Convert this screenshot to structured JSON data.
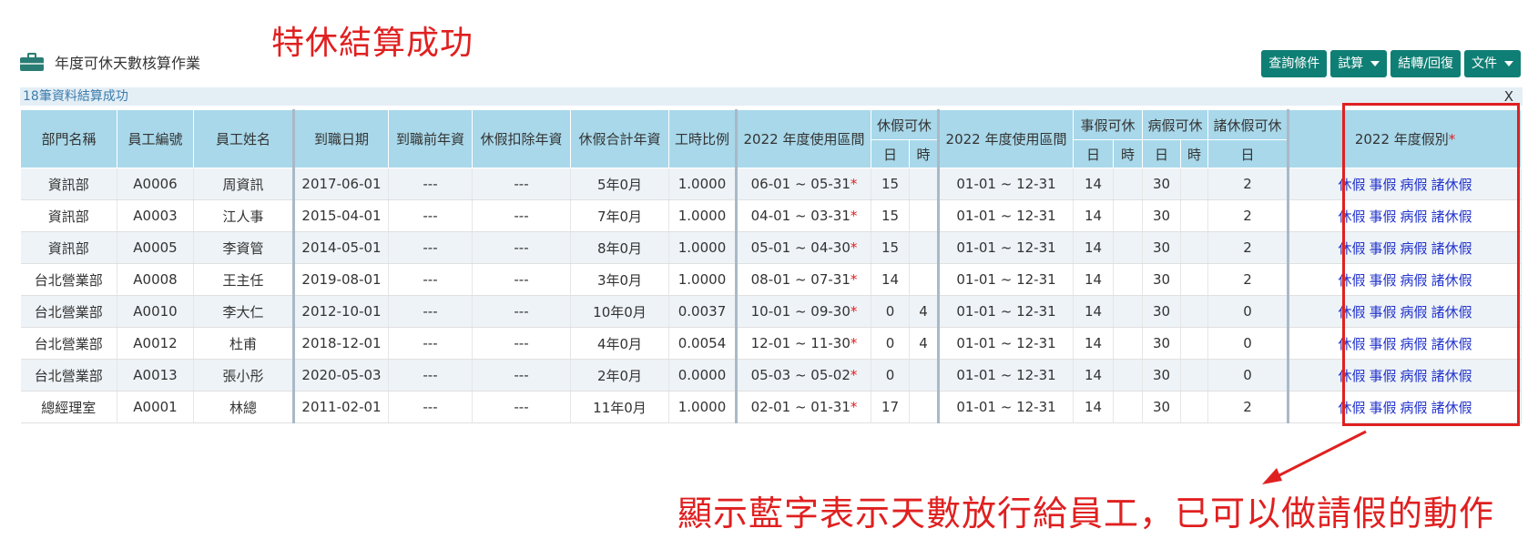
{
  "annotation": {
    "title": "特休結算成功",
    "note": "顯示藍字表示天數放行給員工，已可以做請假的動作"
  },
  "page": {
    "title": "年度可休天數核算作業",
    "status": "18筆資料結算成功",
    "close": "X"
  },
  "toolbar": {
    "query": "查詢條件",
    "trial": "試算",
    "settle": "結轉/回復",
    "docs": "文件"
  },
  "table": {
    "headers": {
      "dept": "部門名稱",
      "emp_no": "員工編號",
      "emp_name": "員工姓名",
      "hire_date": "到職日期",
      "prior_years": "到職前年資",
      "deduct_years": "休假扣除年資",
      "total_years": "休假合計年資",
      "work_ratio": "工時比例",
      "range1": "2022 年度使用區間",
      "annual": "休假可休",
      "range2": "2022 年度使用區間",
      "personal": "事假可休",
      "sick": "病假可休",
      "other": "諸休假可休",
      "types": "2022 年度假別",
      "day": "日",
      "hour": "時"
    },
    "leave_types": [
      "休假",
      "事假",
      "病假",
      "諸休假"
    ],
    "rows": [
      {
        "dept": "資訊部",
        "emp_no": "A0006",
        "emp_name": "周資訊",
        "hire_date": "2017-06-01",
        "prior_years": "---",
        "deduct_years": "---",
        "total_years": "5年0月",
        "work_ratio": "1.0000",
        "range1": "06-01 ~ 05-31",
        "annual_day": "15",
        "annual_hour": "",
        "range2": "01-01 ~ 12-31",
        "personal_day": "14",
        "personal_hour": "",
        "sick_day": "30",
        "sick_hour": "",
        "other_day": "2"
      },
      {
        "dept": "資訊部",
        "emp_no": "A0003",
        "emp_name": "江人事",
        "hire_date": "2015-04-01",
        "prior_years": "---",
        "deduct_years": "---",
        "total_years": "7年0月",
        "work_ratio": "1.0000",
        "range1": "04-01 ~ 03-31",
        "annual_day": "15",
        "annual_hour": "",
        "range2": "01-01 ~ 12-31",
        "personal_day": "14",
        "personal_hour": "",
        "sick_day": "30",
        "sick_hour": "",
        "other_day": "2"
      },
      {
        "dept": "資訊部",
        "emp_no": "A0005",
        "emp_name": "李資管",
        "hire_date": "2014-05-01",
        "prior_years": "---",
        "deduct_years": "---",
        "total_years": "8年0月",
        "work_ratio": "1.0000",
        "range1": "05-01 ~ 04-30",
        "annual_day": "15",
        "annual_hour": "",
        "range2": "01-01 ~ 12-31",
        "personal_day": "14",
        "personal_hour": "",
        "sick_day": "30",
        "sick_hour": "",
        "other_day": "2"
      },
      {
        "dept": "台北營業部",
        "emp_no": "A0008",
        "emp_name": "王主任",
        "hire_date": "2019-08-01",
        "prior_years": "---",
        "deduct_years": "---",
        "total_years": "3年0月",
        "work_ratio": "1.0000",
        "range1": "08-01 ~ 07-31",
        "annual_day": "14",
        "annual_hour": "",
        "range2": "01-01 ~ 12-31",
        "personal_day": "14",
        "personal_hour": "",
        "sick_day": "30",
        "sick_hour": "",
        "other_day": "2"
      },
      {
        "dept": "台北營業部",
        "emp_no": "A0010",
        "emp_name": "李大仁",
        "hire_date": "2012-10-01",
        "prior_years": "---",
        "deduct_years": "---",
        "total_years": "10年0月",
        "work_ratio": "0.0037",
        "range1": "10-01 ~ 09-30",
        "annual_day": "0",
        "annual_hour": "4",
        "range2": "01-01 ~ 12-31",
        "personal_day": "14",
        "personal_hour": "",
        "sick_day": "30",
        "sick_hour": "",
        "other_day": "0"
      },
      {
        "dept": "台北營業部",
        "emp_no": "A0012",
        "emp_name": "杜甫",
        "hire_date": "2018-12-01",
        "prior_years": "---",
        "deduct_years": "---",
        "total_years": "4年0月",
        "work_ratio": "0.0054",
        "range1": "12-01 ~ 11-30",
        "annual_day": "0",
        "annual_hour": "4",
        "range2": "01-01 ~ 12-31",
        "personal_day": "14",
        "personal_hour": "",
        "sick_day": "30",
        "sick_hour": "",
        "other_day": "0"
      },
      {
        "dept": "台北營業部",
        "emp_no": "A0013",
        "emp_name": "張小彤",
        "hire_date": "2020-05-03",
        "prior_years": "---",
        "deduct_years": "---",
        "total_years": "2年0月",
        "work_ratio": "0.0000",
        "range1": "05-03 ~ 05-02",
        "annual_day": "0",
        "annual_hour": "",
        "range2": "01-01 ~ 12-31",
        "personal_day": "14",
        "personal_hour": "",
        "sick_day": "30",
        "sick_hour": "",
        "other_day": "0"
      },
      {
        "dept": "總經理室",
        "emp_no": "A0001",
        "emp_name": "林總",
        "hire_date": "2011-02-01",
        "prior_years": "---",
        "deduct_years": "---",
        "total_years": "11年0月",
        "work_ratio": "1.0000",
        "range1": "02-01 ~ 01-31",
        "annual_day": "17",
        "annual_hour": "",
        "range2": "01-01 ~ 12-31",
        "personal_day": "14",
        "personal_hour": "",
        "sick_day": "30",
        "sick_hour": "",
        "other_day": "2"
      }
    ]
  },
  "colors": {
    "toolbar": "#0f7f75",
    "header": "#a8d8ea",
    "annotation": "#e02020",
    "link": "#2233cc"
  }
}
